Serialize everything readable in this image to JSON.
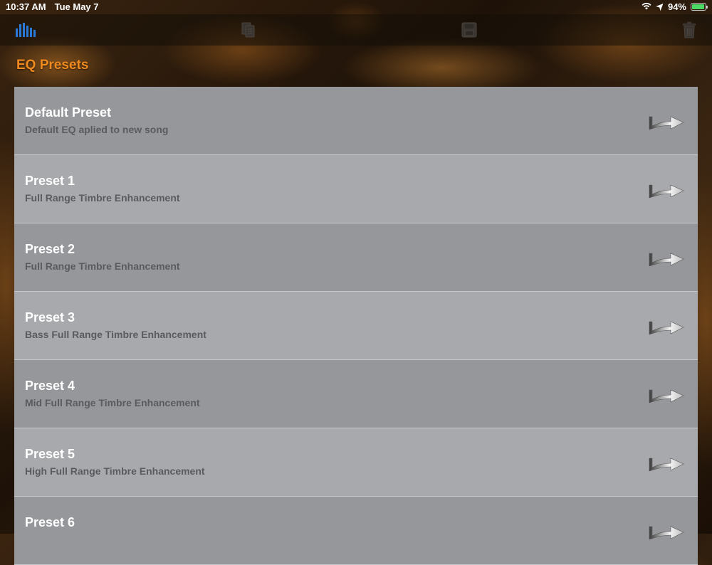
{
  "status_bar": {
    "time": "10:37 AM",
    "date": "Tue May 7",
    "battery": "94%",
    "battery_level": 0.94
  },
  "toolbar": {
    "icons": [
      "equalizer-icon",
      "copy-icon",
      "save-icon",
      "trash-icon"
    ],
    "accent_color": "#2a79d6"
  },
  "section": {
    "title": "EQ Presets",
    "title_color": "#f08a1e"
  },
  "presets": [
    {
      "title": "Default Preset",
      "subtitle": "Default EQ aplied to new song"
    },
    {
      "title": "Preset 1",
      "subtitle": "Full Range Timbre Enhancement"
    },
    {
      "title": "Preset 2",
      "subtitle": "Full Range Timbre Enhancement"
    },
    {
      "title": "Preset 3",
      "subtitle": "Bass Full Range Timbre Enhancement"
    },
    {
      "title": "Preset 4",
      "subtitle": "Mid Full Range Timbre Enhancement"
    },
    {
      "title": "Preset 5",
      "subtitle": "High Full Range Timbre Enhancement"
    },
    {
      "title": "Preset 6",
      "subtitle": ""
    }
  ]
}
